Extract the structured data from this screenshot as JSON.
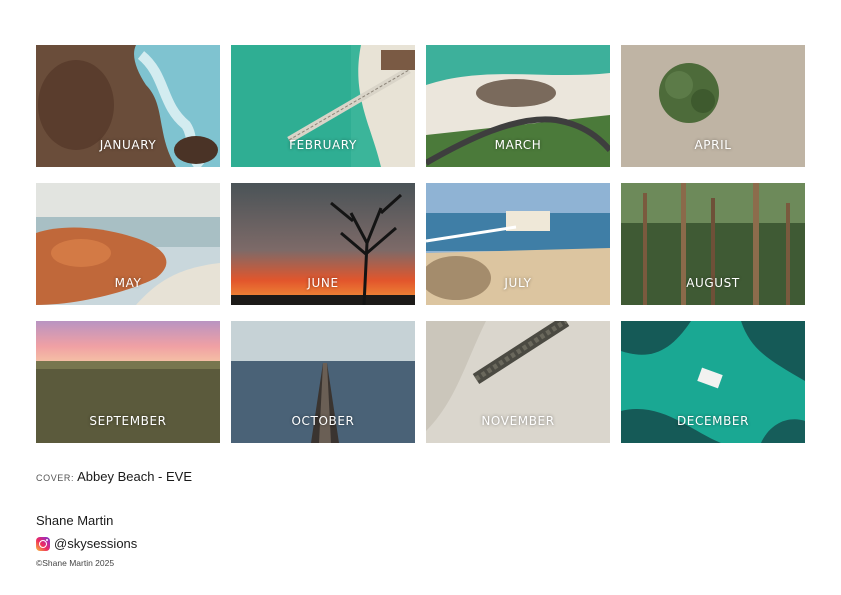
{
  "months": [
    {
      "label": "JANUARY",
      "scene": "rocky-waves"
    },
    {
      "label": "FEBRUARY",
      "scene": "jetty-turquoise"
    },
    {
      "label": "MARCH",
      "scene": "coastal-road"
    },
    {
      "label": "APRIL",
      "scene": "lone-tree"
    },
    {
      "label": "MAY",
      "scene": "orange-rocks"
    },
    {
      "label": "JUNE",
      "scene": "dead-tree-sunset"
    },
    {
      "label": "JULY",
      "scene": "boatshed-beach"
    },
    {
      "label": "AUGUST",
      "scene": "tall-forest"
    },
    {
      "label": "SEPTEMBER",
      "scene": "pink-sky-forest"
    },
    {
      "label": "OCTOBER",
      "scene": "long-jetty"
    },
    {
      "label": "NOVEMBER",
      "scene": "sand-groyne"
    },
    {
      "label": "DECEMBER",
      "scene": "boat-reef"
    }
  ],
  "cover": {
    "label": "COVER:",
    "title": "Abbey Beach - EVE"
  },
  "author": {
    "name": "Shane Martin",
    "handle": "@skysessions",
    "copyright": "©Shane Martin 2025",
    "social_icon": "instagram-icon"
  }
}
